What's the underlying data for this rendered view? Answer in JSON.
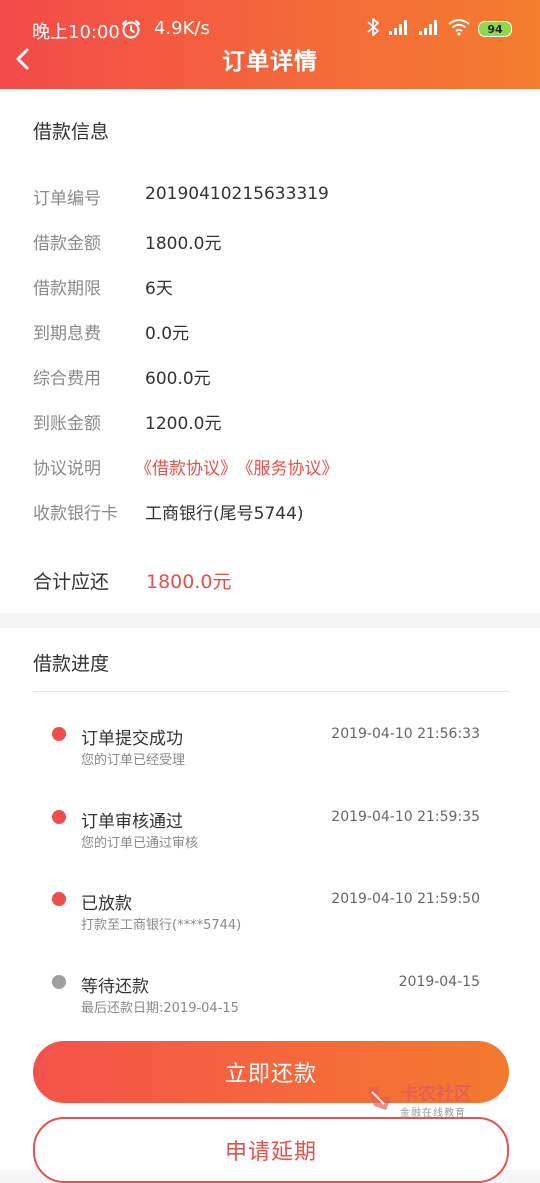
{
  "status_bar": {
    "time": "晚上10:00",
    "net_speed": "4.9K/s",
    "battery": "94",
    "battery_color": "#8fd84a"
  },
  "header": {
    "title": "订单详情",
    "gradient_start": "#f34a4a",
    "gradient_end": "#f47d2e"
  },
  "loan_info": {
    "title": "借款信息",
    "rows": [
      {
        "label": "订单编号",
        "value": "20190410215633319"
      },
      {
        "label": "借款金额",
        "value": "1800.0元"
      },
      {
        "label": "借款期限",
        "value": "6天"
      },
      {
        "label": "到期息费",
        "value": "0.0元"
      },
      {
        "label": "综合费用",
        "value": "600.0元"
      },
      {
        "label": "到账金额",
        "value": "1200.0元"
      }
    ],
    "agreement": {
      "label": "协议说明",
      "loan_agreement": "《借款协议》",
      "service_agreement": "《服务协议》"
    },
    "bank": {
      "label": "收款银行卡",
      "value": "工商银行(尾号5744)"
    },
    "total": {
      "label": "合计应还",
      "value": "1800.0元"
    }
  },
  "progress": {
    "title": "借款进度",
    "steps": [
      {
        "title": "订单提交成功",
        "sub": "您的订单已经受理",
        "time": "2019-04-10 21:56:33",
        "state": "done"
      },
      {
        "title": "订单审核通过",
        "sub": "您的订单已通过审核",
        "time": "2019-04-10 21:59:35",
        "state": "done"
      },
      {
        "title": "已放款",
        "sub": "打款至工商银行(****5744)",
        "time": "2019-04-10 21:59:50",
        "state": "done"
      },
      {
        "title": "等待还款",
        "sub": "最后还款日期:2019-04-15",
        "time": "2019-04-15",
        "state": "pending"
      }
    ],
    "done_color": "#ee4d4d",
    "pending_color": "#9e9e9e"
  },
  "actions": {
    "repay_label": "立即还款",
    "extend_label": "申请延期"
  },
  "watermark": {
    "name": "卡农社区",
    "sub": "金融在线教育"
  },
  "icons": {
    "back": "chevron-left-icon",
    "alarm": "alarm-clock-icon",
    "bluetooth": "bluetooth-icon",
    "signal": "signal-icon",
    "wifi": "wifi-icon"
  }
}
